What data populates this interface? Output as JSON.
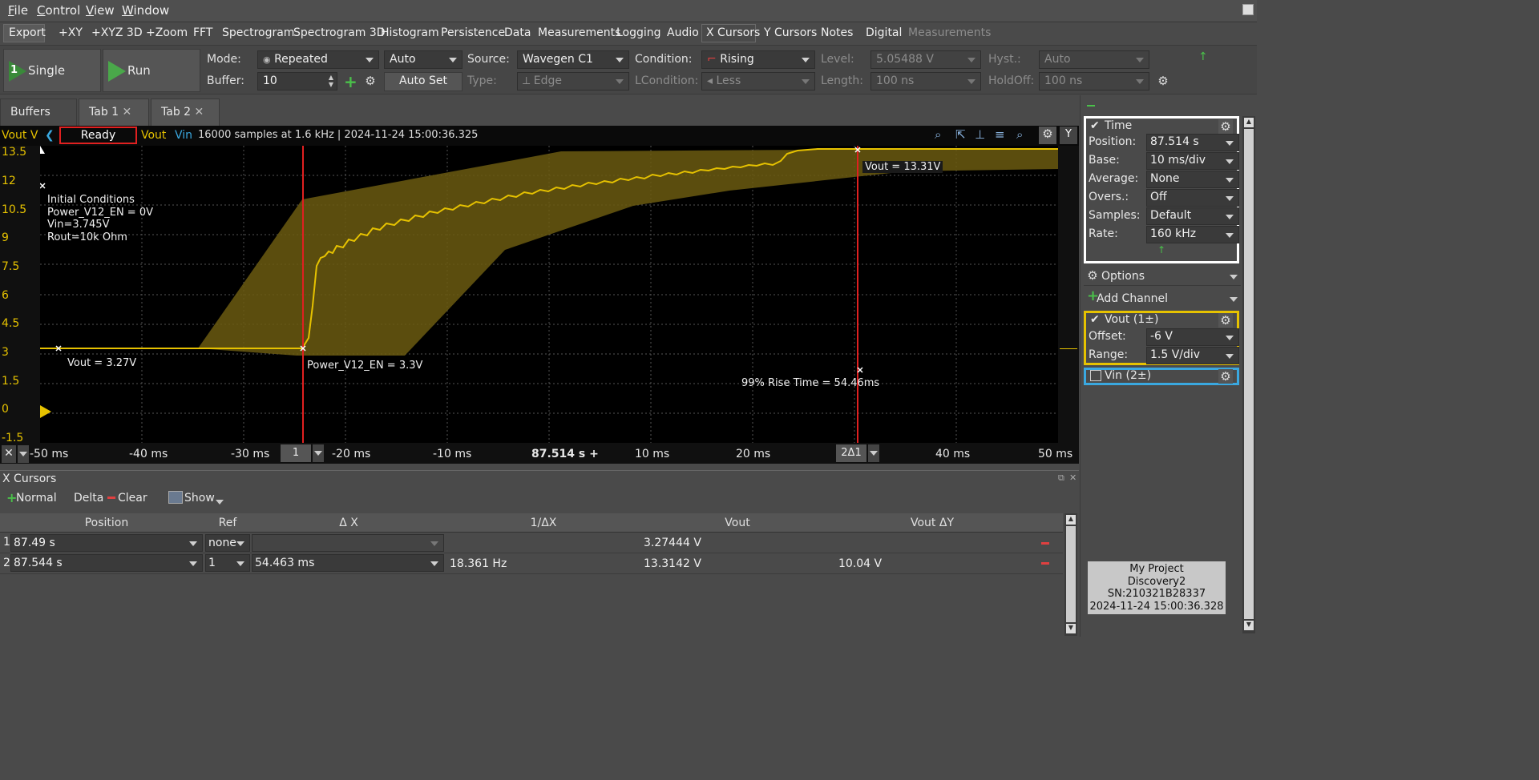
{
  "menu": [
    {
      "label": "File",
      "u": "F",
      "rest": "ile"
    },
    {
      "label": "Control",
      "u": "C",
      "rest": "ontrol"
    },
    {
      "label": "View",
      "u": "V",
      "rest": "iew"
    },
    {
      "label": "Window",
      "u": "W",
      "rest": "indow"
    }
  ],
  "instruments": {
    "export": "Export",
    "items": [
      "+XY",
      "+XYZ 3D",
      "+Zoom",
      "FFT",
      "Spectrogram",
      "Spectrogram 3D",
      "Histogram",
      "Persistence",
      "Data",
      "Measurements",
      "Logging",
      "Audio",
      "X Cursors",
      "Y Cursors",
      "Notes",
      "Digital"
    ],
    "disabled": "Measurements"
  },
  "controls": {
    "single": "Single",
    "single_badge": "1",
    "run": "Run",
    "mode_label": "Mode:",
    "mode_value": "Repeated",
    "auto_value": "Auto",
    "buffer_label": "Buffer:",
    "buffer_value": "10",
    "auto_set": "Auto Set",
    "source_label": "Source:",
    "source_value": "Wavegen C1",
    "type_label": "Type:",
    "type_value": "Edge",
    "condition_label": "Condition:",
    "condition_value": "Rising",
    "lcondition_label": "LCondition:",
    "lcondition_value": "Less",
    "level_label": "Level:",
    "level_value": "5.05488 V",
    "length_label": "Length:",
    "length_value": "100 ns",
    "hyst_label": "Hyst.:",
    "hyst_value": "Auto",
    "holdoff_label": "HoldOff:",
    "holdoff_value": "100 ns"
  },
  "tabs": {
    "buffers": "Buffers",
    "tab1": "Tab 1",
    "tab2": "Tab 2"
  },
  "plot": {
    "y_unit": "Vout V",
    "status": "Ready",
    "ch1": "Vout",
    "ch2": "Vin",
    "info": "16000 samples at 1.6 kHz | 2024-11-24 15:00:36.325",
    "y_btn": "Y",
    "y_ticks": [
      "13.5",
      "12",
      "10.5",
      "9",
      "7.5",
      "6",
      "4.5",
      "3",
      "1.5",
      "0",
      "-1.5"
    ],
    "x_ticks": [
      "-50 ms",
      "-40 ms",
      "-30 ms",
      "-20 ms",
      "-10 ms",
      "87.514 s +",
      "10 ms",
      "20 ms",
      "30 ms",
      "40 ms",
      "50 ms"
    ],
    "cursor1_label": "1",
    "cursor2_label": "2Δ1",
    "notes": {
      "initial": [
        "Initial Conditions",
        "Power_V12_EN = 0V",
        "Vin=3.745V",
        "Rout=10k Ohm"
      ],
      "vout_start": "Vout = 3.27V",
      "power_en": "Power_V12_EN = 3.3V",
      "vout_end": "Vout = 13.31V",
      "rise_time": "99% Rise Time = 54.46ms"
    }
  },
  "xcursors": {
    "title": "X Cursors",
    "normal": "Normal",
    "delta": "Delta",
    "clear": "Clear",
    "show": "Show",
    "headers": [
      "Position",
      "Ref",
      "Δ X",
      "1/ΔX",
      "Vout",
      "Vout ΔY"
    ],
    "rows": [
      {
        "idx": "1",
        "position": "87.49 s",
        "ref": "none",
        "dx": "",
        "inv": "",
        "vout": "3.27444 V",
        "dy": ""
      },
      {
        "idx": "2",
        "position": "87.544 s",
        "ref": "1",
        "dx": "54.463 ms",
        "inv": "18.361 Hz",
        "vout": "13.3142 V",
        "dy": "10.04 V"
      }
    ]
  },
  "right": {
    "time_title": "Time",
    "time_rows": [
      {
        "label": "Position:",
        "value": "87.514 s"
      },
      {
        "label": "Base:",
        "value": "10 ms/div"
      },
      {
        "label": "Average:",
        "value": "None"
      },
      {
        "label": "Overs.:",
        "value": "Off"
      },
      {
        "label": "Samples:",
        "value": "Default"
      },
      {
        "label": "Rate:",
        "value": "160 kHz"
      }
    ],
    "options": "Options",
    "add_channel": "Add Channel",
    "vout_title": "Vout (1±)",
    "offset_label": "Offset:",
    "offset_value": "-6 V",
    "range_label": "Range:",
    "range_value": "1.5 V/div",
    "vin_title": "Vin (2±)",
    "device": [
      "My Project",
      "Discovery2",
      "SN:210321B28337",
      "2024-11-24 15:00:36.328"
    ]
  },
  "colors": {
    "vout": "#e6c200",
    "vin": "#3aa8e0",
    "cursor": "#e02020",
    "envelope": "#6b5a10"
  }
}
